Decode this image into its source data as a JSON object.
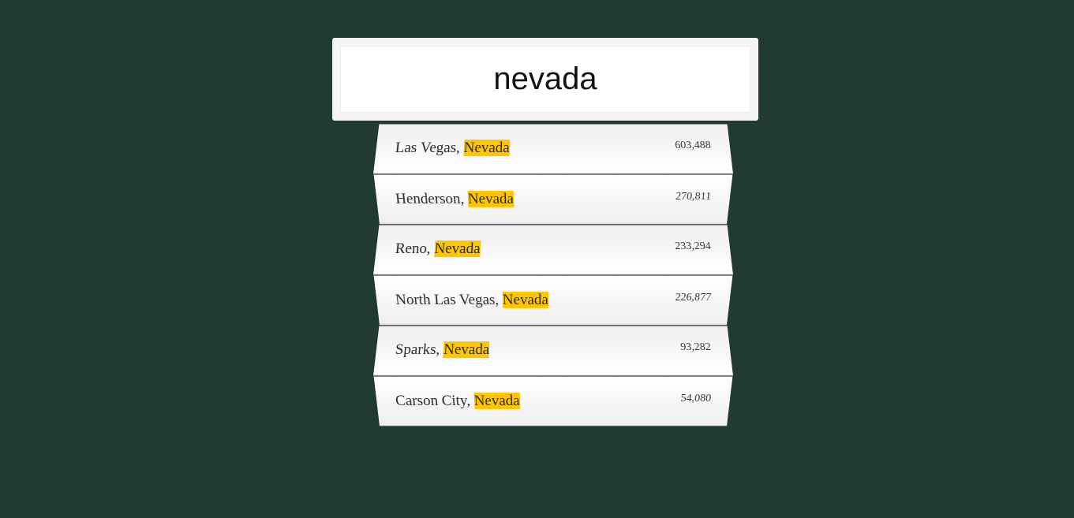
{
  "search": {
    "value": "nevada"
  },
  "suggestions": [
    {
      "city": "Las Vegas, ",
      "state": "Nevada",
      "population": "603,488"
    },
    {
      "city": "Henderson, ",
      "state": "Nevada",
      "population": "270,811"
    },
    {
      "city": "Reno, ",
      "state": "Nevada",
      "population": "233,294"
    },
    {
      "city": "North Las Vegas, ",
      "state": "Nevada",
      "population": "226,877"
    },
    {
      "city": "Sparks, ",
      "state": "Nevada",
      "population": "93,282"
    },
    {
      "city": "Carson City, ",
      "state": "Nevada",
      "population": "54,080"
    }
  ],
  "colors": {
    "background": "#213a34",
    "highlight": "#ffc600"
  }
}
